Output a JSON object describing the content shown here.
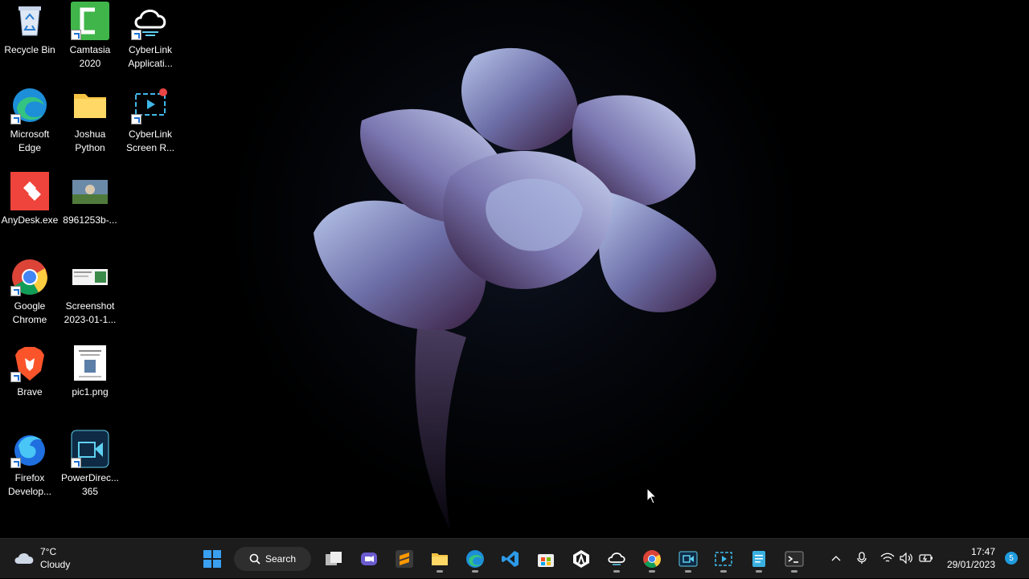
{
  "desktop": {
    "icons": [
      {
        "label": "Recycle Bin",
        "icon": "recycle-bin-icon"
      },
      {
        "label": "Camtasia 2020",
        "icon": "camtasia-icon"
      },
      {
        "label": "CyberLink Applicati...",
        "icon": "cyberlink-cloud-icon"
      },
      {
        "label": "Microsoft Edge",
        "icon": "edge-icon"
      },
      {
        "label": "Joshua Python",
        "icon": "folder-icon"
      },
      {
        "label": "CyberLink Screen R...",
        "icon": "screen-recorder-icon"
      },
      {
        "label": "AnyDesk.exe",
        "icon": "anydesk-icon"
      },
      {
        "label": "8961253b-...",
        "icon": "image-thumbnail-icon"
      },
      {
        "label": "Google Chrome",
        "icon": "chrome-icon"
      },
      {
        "label": "Screenshot 2023-01-1...",
        "icon": "screenshot-thumbnail-icon"
      },
      {
        "label": "Brave",
        "icon": "brave-icon"
      },
      {
        "label": "pic1.png",
        "icon": "document-thumbnail-icon"
      },
      {
        "label": "Firefox Develop...",
        "icon": "firefox-dev-icon"
      },
      {
        "label": "PowerDirec... 365",
        "icon": "powerdirector-icon"
      }
    ]
  },
  "taskbar": {
    "weather": {
      "temp": "7°C",
      "condition": "Cloudy",
      "icon": "cloud-icon"
    },
    "search_label": "Search",
    "apps": [
      {
        "name": "start",
        "icon": "windows-start-icon"
      },
      {
        "name": "task-view",
        "icon": "task-view-icon"
      },
      {
        "name": "teams-chat",
        "icon": "chat-icon"
      },
      {
        "name": "sublime",
        "icon": "sublime-icon"
      },
      {
        "name": "file-explorer",
        "icon": "folder-icon"
      },
      {
        "name": "edge",
        "icon": "edge-icon"
      },
      {
        "name": "vscode",
        "icon": "vscode-icon"
      },
      {
        "name": "store",
        "icon": "store-icon"
      },
      {
        "name": "app",
        "icon": "hexagon-app-icon"
      },
      {
        "name": "cyberlink-cloud",
        "icon": "cyberlink-cloud-icon"
      },
      {
        "name": "chrome",
        "icon": "chrome-icon"
      },
      {
        "name": "powerdirector",
        "icon": "powerdirector-icon"
      },
      {
        "name": "screen-recorder",
        "icon": "screen-recorder-icon"
      },
      {
        "name": "notepad",
        "icon": "notepad-icon"
      },
      {
        "name": "terminal",
        "icon": "terminal-icon"
      }
    ],
    "tray": {
      "time": "17:47",
      "date": "29/01/2023",
      "notifications": "5"
    }
  }
}
